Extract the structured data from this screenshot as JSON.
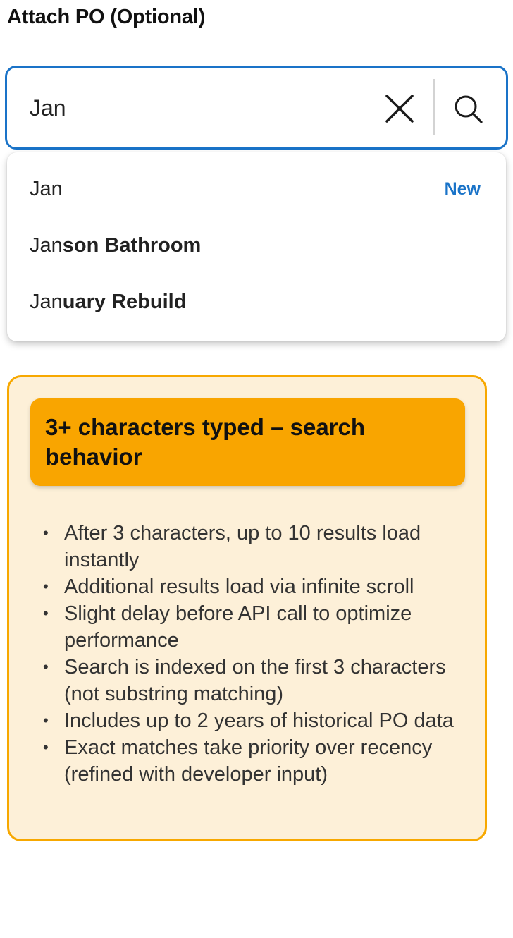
{
  "field": {
    "label": "Attach PO (Optional)"
  },
  "search": {
    "value": "Jan",
    "clear_icon": "close-icon",
    "search_icon": "search-icon",
    "border_color": "#1a73c8"
  },
  "dropdown": {
    "items": [
      {
        "typed": "Jan",
        "rest": "",
        "badge": "New"
      },
      {
        "typed": "Jan",
        "rest": "son Bathroom",
        "badge": ""
      },
      {
        "typed": "Jan",
        "rest": "uary Rebuild",
        "badge": ""
      }
    ]
  },
  "info": {
    "title": "3+ characters typed – search behavior",
    "bullets": [
      "After 3 characters, up to 10 results load instantly",
      "Additional results load via infinite scroll",
      "Slight delay before API call to optimize performance",
      "Search is indexed on the first 3 characters (not substring matching)",
      "Includes up to 2 years of historical PO data",
      "Exact matches take priority over recency (refined with developer input)"
    ],
    "accent_color": "#f9a500",
    "background_color": "#fdf0d8"
  }
}
